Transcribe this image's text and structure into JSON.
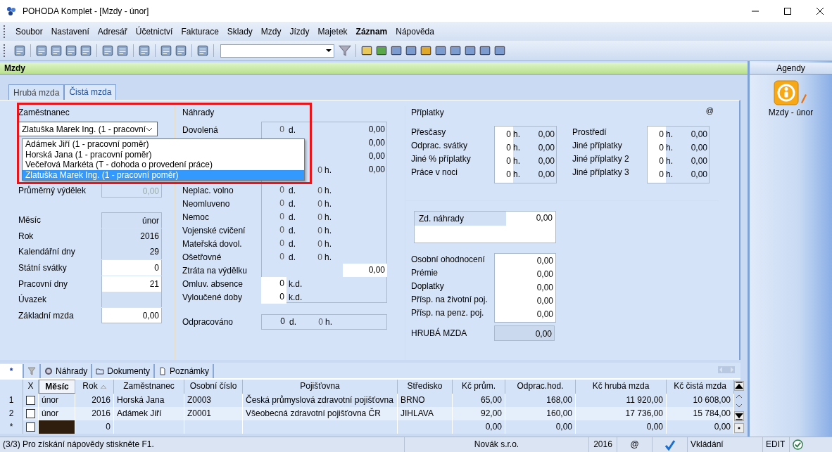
{
  "window": {
    "title": "POHODA Komplet - [Mzdy - únor]"
  },
  "menu": [
    {
      "label": "Soubor",
      "emphasized": false
    },
    {
      "label": "Nastavení",
      "emphasized": false
    },
    {
      "label": "Adresář",
      "emphasized": false
    },
    {
      "label": "Účetnictví",
      "emphasized": false
    },
    {
      "label": "Fakturace",
      "emphasized": false
    },
    {
      "label": "Sklady",
      "emphasized": false
    },
    {
      "label": "Mzdy",
      "emphasized": false
    },
    {
      "label": "Jízdy",
      "emphasized": false
    },
    {
      "label": "Majetek",
      "emphasized": false
    },
    {
      "label": "Záznam",
      "emphasized": true
    },
    {
      "label": "Nápověda",
      "emphasized": false
    }
  ],
  "agenda": {
    "title": "Mzdy"
  },
  "form_tabs": [
    {
      "label": "Hrubá mzda",
      "selected": true
    },
    {
      "label": "Čistá mzda",
      "selected": false
    }
  ],
  "employee": {
    "title": "Zaměstnanec",
    "value": "Zlatuška Marek Ing. (1 - pracovní",
    "options": [
      {
        "label": "Adámek Jiří (1 - pracovní poměr)",
        "selected": false
      },
      {
        "label": "Horská Jana (1 - pracovní poměr)",
        "selected": false
      },
      {
        "label": "Večeřová Markéta (T - dohoda o provedení práce)",
        "selected": false
      },
      {
        "label": "Zlatuška Marek Ing. (1 - pracovní poměr)",
        "selected": true
      }
    ]
  },
  "average_earnings": {
    "label": "Průměrný výdělek",
    "value": "0,00"
  },
  "period": [
    {
      "label": "Měsíc",
      "value": "únor",
      "editable": false
    },
    {
      "label": "Rok",
      "value": "2016",
      "editable": false
    },
    {
      "label": "Kalendářní dny",
      "value": "29",
      "editable": false
    },
    {
      "label": "Státní svátky",
      "value": "0",
      "editable": true
    },
    {
      "label": "Pracovní dny",
      "value": "21",
      "editable": true
    },
    {
      "label": "Úvazek",
      "editable": false
    },
    {
      "label": "Základní mzda",
      "value": "0,00",
      "editable": true
    }
  ],
  "nahrady": {
    "title": "Náhrady",
    "rows": [
      {
        "label": "Dovolená",
        "days": "0",
        "days_unit": "d.",
        "amount": "0,00",
        "editable": false
      },
      {
        "amount": "0,00",
        "editable": false
      },
      {
        "amount": "0,00",
        "editable": false
      },
      {
        "hours": "0",
        "hours_unit": "h.",
        "amount": "0,00",
        "editable": false
      },
      {
        "label": "Neplac. volno",
        "days": "0",
        "days_unit": "d.",
        "hours": "0",
        "hours_unit": "h.",
        "editable": false
      },
      {
        "label": "Neomluveno",
        "days": "0",
        "days_unit": "d.",
        "hours": "0",
        "hours_unit": "h.",
        "editable": false
      },
      {
        "label": "Nemoc",
        "days": "0",
        "days_unit": "d.",
        "hours": "0",
        "hours_unit": "h.",
        "editable": false
      },
      {
        "label": "Vojenské cvičení",
        "days": "0",
        "days_unit": "d.",
        "hours": "0",
        "hours_unit": "h.",
        "editable": false
      },
      {
        "label": "Mateřská dovol.",
        "days": "0",
        "days_unit": "d.",
        "hours": "0",
        "hours_unit": "h.",
        "editable": false
      },
      {
        "label": "Ošetřovné",
        "days": "0",
        "days_unit": "d.",
        "hours": "0",
        "hours_unit": "h.",
        "editable": false
      },
      {
        "label": "Ztráta na výdělku",
        "amount": "0,00",
        "editable": true
      },
      {
        "label": "Omluv. absence",
        "days": "0",
        "days_unit": "k.d.",
        "editable": true
      },
      {
        "label": "Vyloučené doby",
        "days": "0",
        "days_unit": "k.d.",
        "editable": true
      }
    ],
    "worked": {
      "label": "Odpracováno",
      "days": "0",
      "days_unit": "d.",
      "hours": "0",
      "hours_unit": "h."
    }
  },
  "priplatky": {
    "title": "Příplatky",
    "symbol": "@",
    "groups": [
      [
        {
          "label": "Přesčasy",
          "hours": "0",
          "unit": "h.",
          "amount": "0,00"
        },
        {
          "label": "Odprac. svátky",
          "hours": "0",
          "unit": "h.",
          "amount": "0,00"
        },
        {
          "label": "Jiné % příplatky",
          "hours": "0",
          "unit": "h.",
          "amount": "0,00"
        },
        {
          "label": "Práce v noci",
          "hours": "0",
          "unit": "h.",
          "amount": "0,00"
        }
      ],
      [
        {
          "label": "Prostředí",
          "hours": "0",
          "unit": "h.",
          "amount": "0,00"
        },
        {
          "label": "Jiné příplatky",
          "hours": "0",
          "unit": "h.",
          "amount": "0,00"
        },
        {
          "label": "Jiné příplatky 2",
          "hours": "0",
          "unit": "h.",
          "amount": "0,00"
        },
        {
          "label": "Jiné příplatky 3",
          "hours": "0",
          "unit": "h.",
          "amount": "0,00"
        }
      ]
    ],
    "taxable": {
      "label": "Zd. náhrady",
      "value": "0,00"
    },
    "extras": [
      {
        "label": "Osobní ohodnocení",
        "value": "0,00"
      },
      {
        "label": "Prémie",
        "value": "0,00"
      },
      {
        "label": "Doplatky",
        "value": "0,00"
      },
      {
        "label": "Přísp. na životní poj.",
        "value": "0,00"
      },
      {
        "label": "Přísp. na penz. poj.",
        "value": "0,00"
      }
    ],
    "gross": {
      "label": "HRUBÁ MZDA",
      "value": "0,00"
    }
  },
  "bottom_tabs": [
    {
      "label": "*",
      "kind": "star",
      "selected": true
    },
    {
      "kind": "filter",
      "selected": false
    },
    {
      "label": "Náhrady",
      "kind": "disc",
      "selected": false
    },
    {
      "label": "Dokumenty",
      "kind": "folder",
      "selected": false
    },
    {
      "label": "Poznámky",
      "kind": "note",
      "selected": false
    }
  ],
  "table": {
    "columns": [
      "X",
      "Měsíc",
      "Rok",
      "Zaměstnanec",
      "Osobní číslo",
      "Pojišťovna",
      "Středisko",
      "Kč prům.",
      "Odprac.hod.",
      "Kč hrubá mzda",
      "Kč čistá mzda"
    ],
    "rows": [
      {
        "header": "1",
        "checked": false,
        "cells": [
          "",
          "únor",
          "2016",
          "Horská Jana",
          "Z0003",
          "Česká průmyslová zdravotní pojišťovna",
          "BRNO",
          "65,00",
          "168,00",
          "11 920,00",
          "10 608,00"
        ]
      },
      {
        "header": "2",
        "checked": false,
        "cells": [
          "",
          "únor",
          "2016",
          "Adámek Jiří",
          "Z0001",
          "Všeobecná zdravotní pojišťovna ČR",
          "JIHLAVA",
          "92,00",
          "160,00",
          "17 736,00",
          "15 784,00"
        ]
      },
      {
        "header": "*",
        "checked": false,
        "cells": [
          "",
          "",
          "0",
          "",
          "",
          "",
          "",
          "0,00",
          "0,00",
          "0,00",
          "0,00"
        ]
      }
    ]
  },
  "agendas": {
    "title": "Agendy",
    "items": [
      {
        "label": "Mzdy - únor"
      }
    ]
  },
  "status_bar": {
    "help": "(3/3) Pro získání nápovědy stiskněte F1.",
    "company": "Novák s.r.o.",
    "year": "2016",
    "symbol": "@",
    "mode": "Vkládání",
    "edit": "EDIT"
  }
}
